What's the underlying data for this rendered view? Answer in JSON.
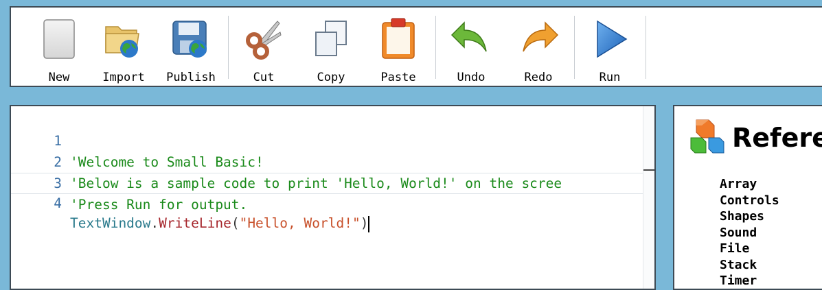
{
  "toolbar": {
    "buttons": [
      {
        "label": "New",
        "icon": "new-file-icon"
      },
      {
        "label": "Import",
        "icon": "import-folder-icon"
      },
      {
        "label": "Publish",
        "icon": "publish-disk-icon"
      },
      {
        "label": "Cut",
        "icon": "scissors-icon"
      },
      {
        "label": "Copy",
        "icon": "copy-icon"
      },
      {
        "label": "Paste",
        "icon": "clipboard-icon"
      },
      {
        "label": "Undo",
        "icon": "undo-arrow-icon"
      },
      {
        "label": "Redo",
        "icon": "redo-arrow-icon"
      },
      {
        "label": "Run",
        "icon": "play-icon"
      }
    ]
  },
  "editor": {
    "line_numbers": [
      "1",
      "2",
      "3",
      "4"
    ],
    "lines": [
      "'Welcome to Small Basic!",
      "'Below is a sample code to print 'Hello, World!' on the scree",
      "'Press Run for output."
    ],
    "line4": {
      "object": "TextWindow",
      "dot": ".",
      "method": "WriteLine",
      "open": "(",
      "string": "\"Hello, World!\"",
      "close": ")"
    }
  },
  "reference": {
    "title": "Refere",
    "items": [
      "Array",
      "Controls",
      "Shapes",
      "Sound",
      "File",
      "Stack",
      "Timer"
    ]
  },
  "colors": {
    "background": "#7ab8d8",
    "comment": "#1a8a1a",
    "string": "#c8502a",
    "method": "#a6262c",
    "object": "#2a7a8c",
    "line_number": "#3a6fa5"
  }
}
